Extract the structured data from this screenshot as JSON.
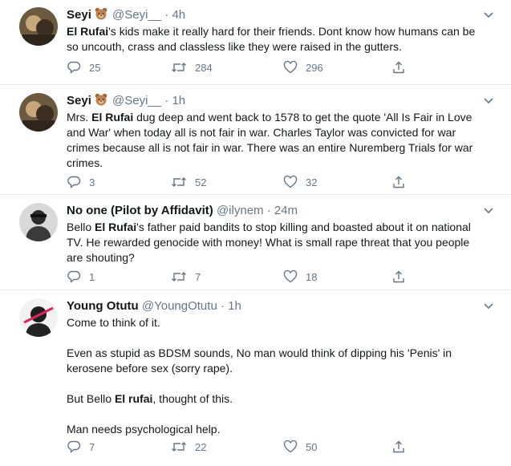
{
  "tweets": [
    {
      "name": "Seyi",
      "handle": "@Seyi__",
      "time": "4h",
      "avatar_icon": "user-photo-avatar",
      "text_parts": [
        "",
        "El Rufai",
        "'s kids make it really hard for their friends. Dont know how humans can be so uncouth, crass and classless like they were raised in the gutters."
      ],
      "replies": "25",
      "retweets": "284",
      "likes": "296"
    },
    {
      "name": "Seyi",
      "handle": "@Seyi__",
      "time": "1h",
      "avatar_icon": "user-photo-avatar",
      "text_parts": [
        "Mrs. ",
        "El Rufai",
        " dug deep and went back to 1578 to get the quote 'All Is Fair in Love and War' when today all is not fair in war. Charles Taylor was convicted for war crimes because all is not fair in war. There was an entire Nuremberg Trials for war crimes."
      ],
      "replies": "3",
      "retweets": "52",
      "likes": "32"
    },
    {
      "name": "No one (Pilot by Affidavit)",
      "handle": "@ilynem",
      "time": "24m",
      "avatar_icon": "user-photo-avatar",
      "text_parts": [
        "Bello ",
        "El Rufai",
        "'s father paid bandits to stop killing and boasted about it on national TV. He rewarded genocide with money! What is small rape threat that you people are shouting?"
      ],
      "replies": "1",
      "retweets": "7",
      "likes": "18"
    },
    {
      "name": "Young Otutu",
      "handle": "@YoungOtutu",
      "time": "1h",
      "avatar_icon": "user-photo-avatar",
      "text_parts": [
        "Come to think of it.\n\nEven as stupid as BDSM sounds, No man would think of dipping his 'Penis' in kerosene before sex (sorry rape).\n\nBut Bello ",
        "El rufai",
        ", thought of this.\n\nMan needs psychological help."
      ],
      "replies": "7",
      "retweets": "22",
      "likes": "50"
    }
  ],
  "separator": "·",
  "colors": {
    "text": "#14171a",
    "muted": "#657786",
    "border": "#e6ecf0"
  }
}
